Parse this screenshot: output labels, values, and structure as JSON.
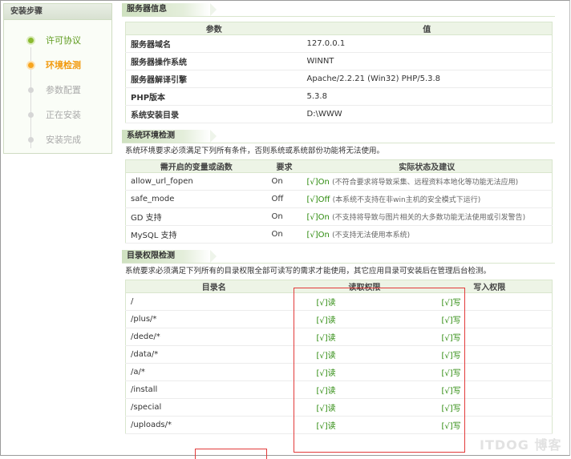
{
  "sidebar": {
    "title": "安装步骤",
    "steps": [
      {
        "label": "许可协议",
        "state": "done"
      },
      {
        "label": "环境检测",
        "state": "active"
      },
      {
        "label": "参数配置",
        "state": "pending"
      },
      {
        "label": "正在安装",
        "state": "pending"
      },
      {
        "label": "安装完成",
        "state": "pending"
      }
    ]
  },
  "server": {
    "title": "服务器信息",
    "head_param": "参数",
    "head_value": "值",
    "rows": [
      {
        "param": "服务器域名",
        "value": "127.0.0.1"
      },
      {
        "param": "服务器操作系统",
        "value": "WINNT"
      },
      {
        "param": "服务器解译引擎",
        "value": "Apache/2.2.21 (Win32) PHP/5.3.8"
      },
      {
        "param": "PHP版本",
        "value": "5.3.8"
      },
      {
        "param": "系统安装目录",
        "value": "D:\\WWW"
      }
    ]
  },
  "env": {
    "title": "系统环境检测",
    "desc": "系统环境要求必须满足下列所有条件，否则系统或系统部份功能将无法使用。",
    "head_name": "需开启的变量或函数",
    "head_req": "要求",
    "head_status": "实际状态及建议",
    "rows": [
      {
        "name": "allow_url_fopen",
        "req": "On",
        "status": "[√]On",
        "note": "(不符合要求将导致采集、远程资料本地化等功能无法应用)"
      },
      {
        "name": "safe_mode",
        "req": "Off",
        "status": "[√]Off",
        "note": "(本系统不支持在非win主机的安全模式下运行)"
      },
      {
        "name": "GD 支持",
        "req": "On",
        "status": "[√]On",
        "note": "(不支持将导致与图片相关的大多数功能无法使用或引发警告)"
      },
      {
        "name": "MySQL 支持",
        "req": "On",
        "status": "[√]On",
        "note": "(不支持无法使用本系统)"
      }
    ]
  },
  "perm": {
    "title": "目录权限检测",
    "desc": "系统要求必须满足下列所有的目录权限全部可读写的需求才能使用，其它应用目录可安装后在管理后台检测。",
    "head_dir": "目录名",
    "head_read": "读取权限",
    "head_write": "写入权限",
    "rows": [
      {
        "dir": "/",
        "read": "[√]读",
        "write": "[√]写"
      },
      {
        "dir": "/plus/*",
        "read": "[√]读",
        "write": "[√]写"
      },
      {
        "dir": "/dede/*",
        "read": "[√]读",
        "write": "[√]写"
      },
      {
        "dir": "/data/*",
        "read": "[√]读",
        "write": "[√]写"
      },
      {
        "dir": "/a/*",
        "read": "[√]读",
        "write": "[√]写"
      },
      {
        "dir": "/install",
        "read": "[√]读",
        "write": "[√]写"
      },
      {
        "dir": "/special",
        "read": "[√]读",
        "write": "[√]写"
      },
      {
        "dir": "/uploads/*",
        "read": "[√]读",
        "write": "[√]写"
      }
    ]
  },
  "watermark": "ITDOG 博客",
  "colors": {
    "accent_green": "#5d9a1c",
    "active_orange": "#f29a0e",
    "ok_green": "#2c8a0c",
    "highlight_red": "#e23a3a"
  }
}
